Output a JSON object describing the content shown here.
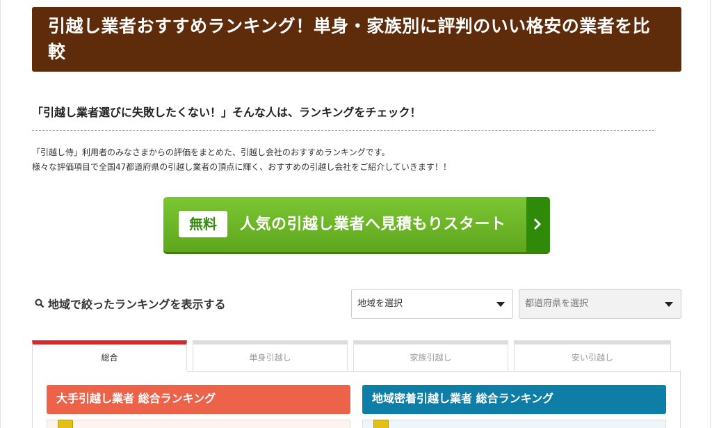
{
  "header": {
    "title": "引越し業者おすすめランキング！単身・家族別に評判のいい格安の業者を比較"
  },
  "lead": {
    "text": "「引越し業者選びに失敗したくない！」そんな人は、ランキングをチェック！"
  },
  "intro": {
    "line1": "「引越し侍」利用者のみなさまからの評価をまとめた、引越し会社のおすすめランキングです。",
    "line2": "様々な評価項目で全国47都道府県の引越し業者の頂点に輝く、おすすめの引越し会社をご紹介していきます！！"
  },
  "cta": {
    "badge": "無料",
    "label": "人気の引越し業者へ見積もりスタート",
    "icon": "chevron-right-icon",
    "color": "#6cb52a"
  },
  "filter": {
    "icon": "search-icon",
    "label": "地域で絞ったランキングを表示する",
    "region_value": "地域を選択",
    "prefecture_value": "都道府県を選択"
  },
  "tabs": [
    {
      "label": "総合",
      "active": true
    },
    {
      "label": "単身引越し",
      "active": false
    },
    {
      "label": "家族引越し",
      "active": false
    },
    {
      "label": "安い引越し",
      "active": false
    }
  ],
  "ranking": {
    "major_title": "大手引越し業者 総合ランキング",
    "major_color": "#ec634a",
    "local_title": "地域密着引越し業者 総合ランキング",
    "local_color": "#0f7ea6"
  },
  "colors": {
    "title_bg": "#5e2c0b",
    "active_tab_accent": "#d8282b"
  }
}
